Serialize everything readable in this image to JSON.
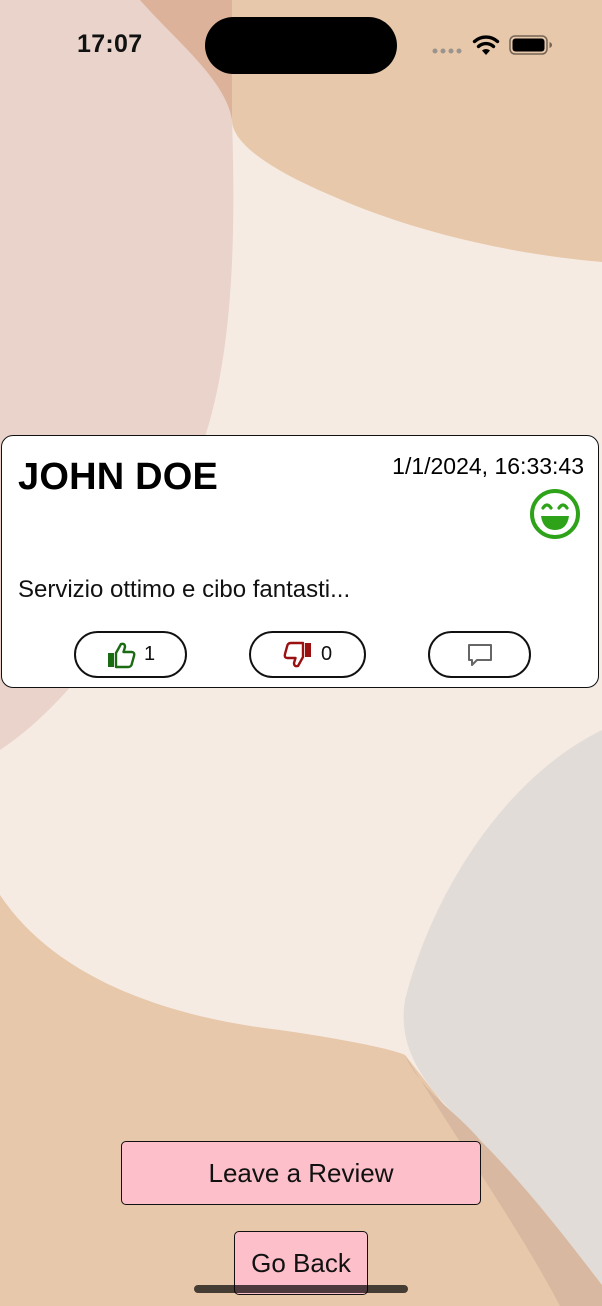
{
  "status_bar": {
    "time": "17:07",
    "icons": [
      "signal-icon",
      "wifi-icon",
      "battery-icon"
    ]
  },
  "review": {
    "author": "JOHN DOE",
    "date": "1/1/2024, 16:33:43",
    "rating_icon": "grinning-face-icon",
    "text": "Servizio ottimo e cibo fantasti...",
    "likes": "1",
    "dislikes": "0",
    "like_icon": "thumbs-up-icon",
    "dislike_icon": "thumbs-down-icon",
    "comment_icon": "comment-icon"
  },
  "actions": {
    "leave_review_label": "Leave a Review",
    "go_back_label": "Go Back"
  },
  "colors": {
    "like_green": "#1a6b12",
    "dislike_red": "#9b1010",
    "rating_green": "#2ea31a",
    "button_pink": "#fdc0cb",
    "bg_cream": "#f5ebe3",
    "bg_tan": "#e8c8aa"
  }
}
